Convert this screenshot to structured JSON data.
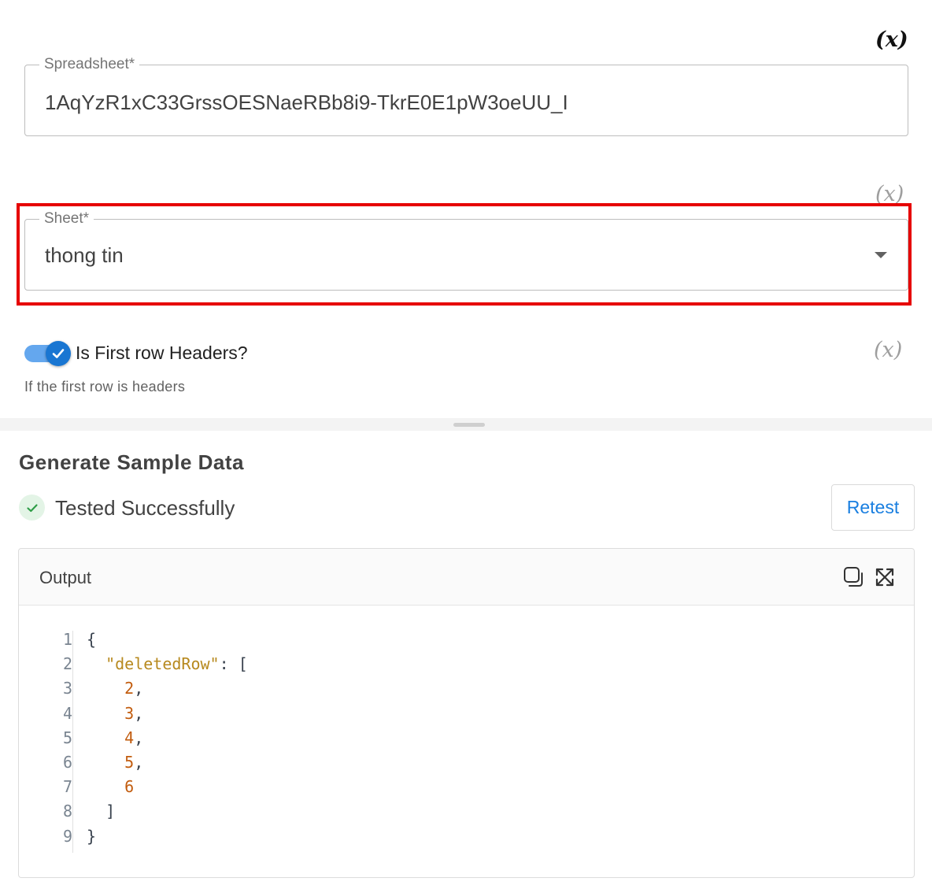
{
  "form": {
    "spreadsheet": {
      "label": "Spreadsheet*",
      "value": "1AqYzR1xC33GrssOESNaeRBb8i9-TkrE0E1pW3oeUU_I",
      "variable_icon": "(x)"
    },
    "sheet": {
      "label": "Sheet*",
      "value": "thong tin",
      "variable_icon": "(x)"
    },
    "first_row_headers": {
      "label": "Is First row Headers?",
      "helper": "If the first row is headers",
      "checked": true,
      "variable_icon": "(x)"
    }
  },
  "sample": {
    "title": "Generate Sample Data",
    "status": "Tested Successfully",
    "retest_label": "Retest"
  },
  "output": {
    "title": "Output",
    "line_numbers": [
      "1",
      "2",
      "3",
      "4",
      "5",
      "6",
      "7",
      "8",
      "9"
    ],
    "code": {
      "open_brace": "{",
      "key": "\"deletedRow\"",
      "colon": ": ",
      "open_bracket": "[",
      "values": [
        "2",
        "3",
        "4",
        "5",
        "6"
      ],
      "close_bracket": "]",
      "close_brace": "}"
    }
  },
  "colors": {
    "accent": "#1976d2",
    "highlight": "#e60000",
    "success": "#2e7d32",
    "json_key": "#b7891e",
    "json_number": "#c25c0e"
  },
  "icons": {
    "variable": "variable-icon",
    "dropdown": "chevron-down-icon",
    "check": "check-icon",
    "copy": "copy-icon",
    "expand": "expand-icon"
  }
}
